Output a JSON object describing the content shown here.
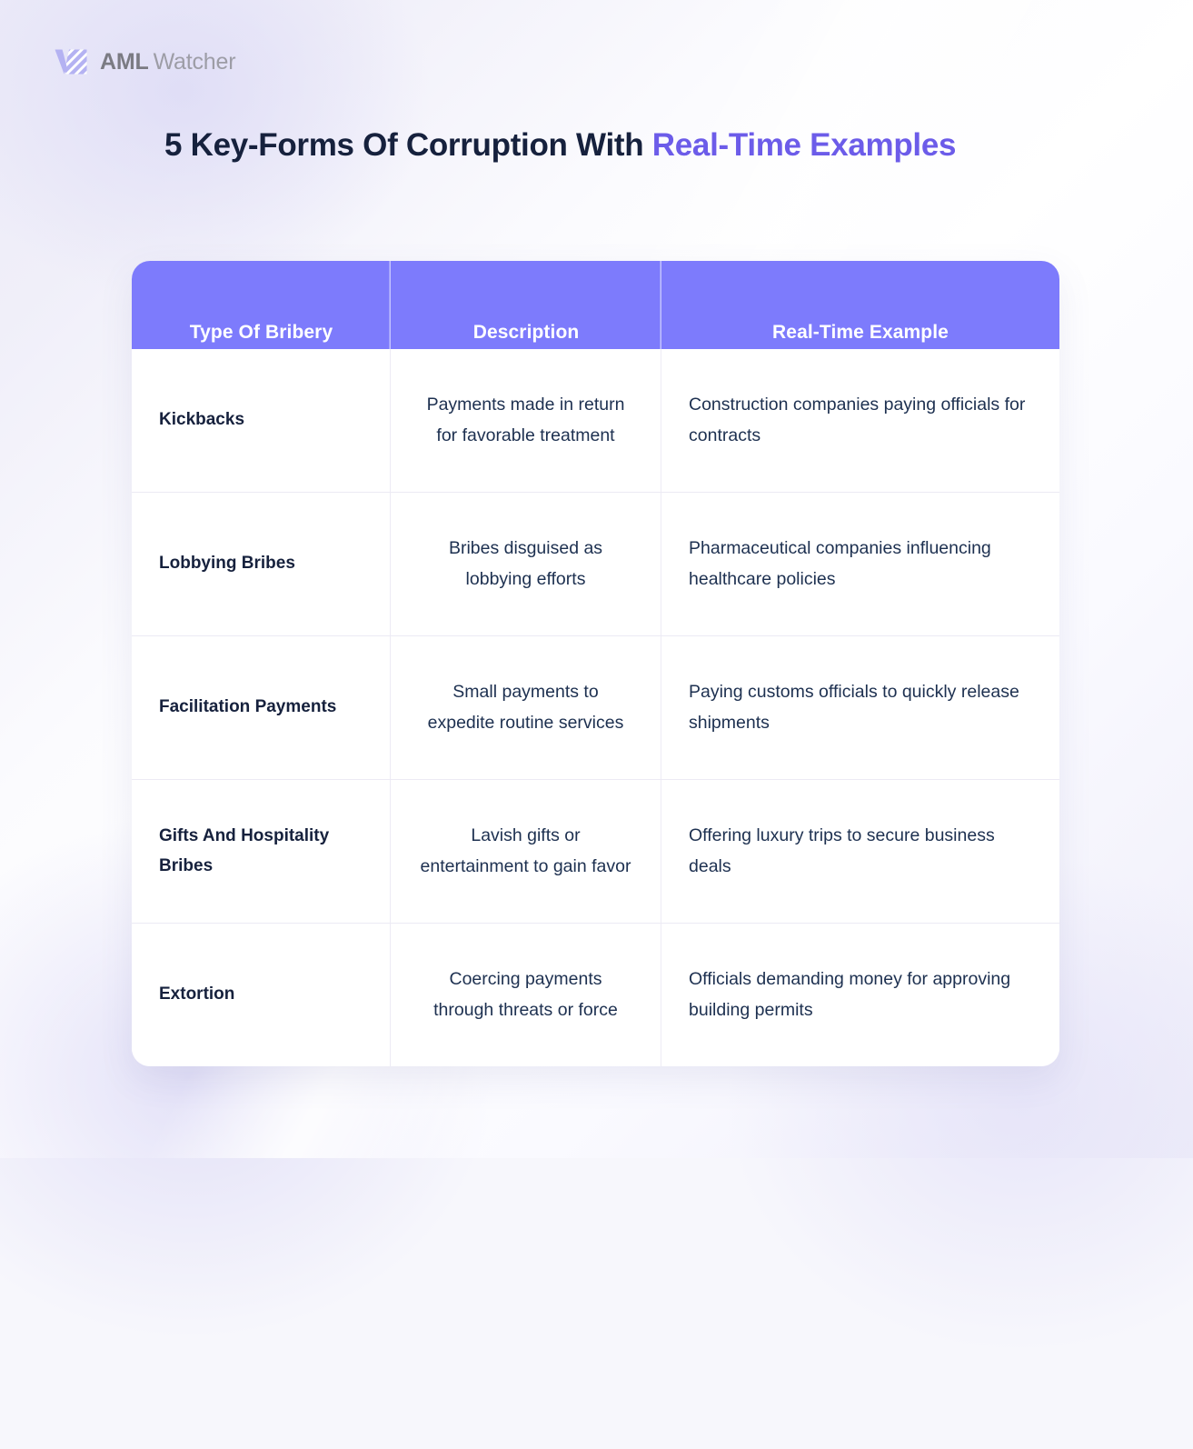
{
  "brand": {
    "logo_icon": "aml-watcher-striped-mark",
    "name_bold": "AML",
    "name_light": "Watcher"
  },
  "title": {
    "lead": "5 Key-Forms Of Corruption With ",
    "accent": "Real-Time Examples"
  },
  "colors": {
    "header_purple": "#7d7bfc",
    "accent_purple": "#6c5ce9",
    "text_navy": "#16213d",
    "body_navy": "#1d3050",
    "card_white": "#ffffff",
    "background_lavender": "#ecebf9"
  },
  "table": {
    "columns": [
      "Type Of Bribery",
      "Description",
      "Real-Time Example"
    ],
    "rows": [
      {
        "type": "Kickbacks",
        "description": "Payments made in return for favorable treatment",
        "example": "Construction companies paying officials for contracts"
      },
      {
        "type": "Lobbying Bribes",
        "description": "Bribes disguised as lobbying efforts",
        "example": "Pharmaceutical companies influencing healthcare policies"
      },
      {
        "type": "Facilitation Payments",
        "description": "Small payments to expedite routine services",
        "example": "Paying customs officials to quickly release shipments"
      },
      {
        "type": "Gifts And Hospitality Bribes",
        "description": "Lavish gifts or entertainment to gain favor",
        "example": "Offering luxury trips to secure business deals"
      },
      {
        "type": "Extortion",
        "description": "Coercing payments through threats or force",
        "example": "Officials demanding money for approving building permits"
      }
    ]
  }
}
